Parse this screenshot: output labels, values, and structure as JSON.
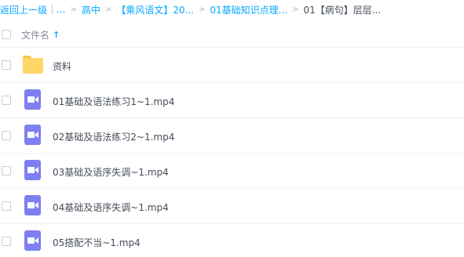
{
  "breadcrumb": {
    "back": "返回上一级",
    "ellipsis": "...",
    "items": [
      "高中",
      "【乘风语文】20...",
      "01基础知识点理..."
    ],
    "current": "01【病句】层层...",
    "separator": ">"
  },
  "list_header": {
    "name_label": "文件名",
    "sort_icon": "arrow-up-icon"
  },
  "files": [
    {
      "name": "资料",
      "type": "folder",
      "icon": "folder-icon"
    },
    {
      "name": "01基础及语法练习1~1.mp4",
      "type": "video",
      "icon": "video-file-icon"
    },
    {
      "name": "02基础及语法练习2~1.mp4",
      "type": "video",
      "icon": "video-file-icon"
    },
    {
      "name": "03基础及语序失调~1.mp4",
      "type": "video",
      "icon": "video-file-icon"
    },
    {
      "name": "04基础及语序失调~1.mp4",
      "type": "video",
      "icon": "video-file-icon"
    },
    {
      "name": "05搭配不当~1.mp4",
      "type": "video",
      "icon": "video-file-icon"
    }
  ],
  "colors": {
    "link": "#06a7ff",
    "folder": "#ffd768",
    "video": "#7e7ff1",
    "text": "#454d5a",
    "muted": "#878c9c"
  }
}
